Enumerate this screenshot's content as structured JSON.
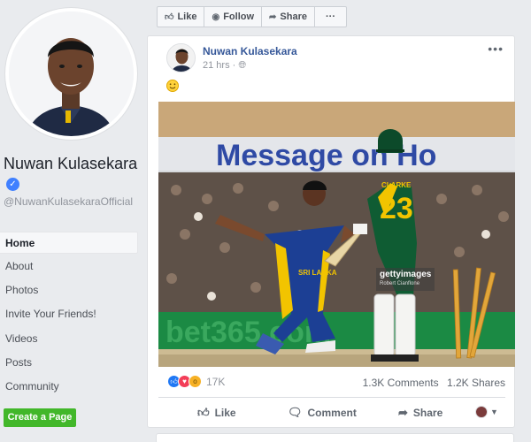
{
  "sidebar": {
    "name": "Nuwan Kulasekara",
    "handle": "@NuwanKulasekaraOfficial",
    "verified": true,
    "nav": [
      "Home",
      "About",
      "Photos",
      "Invite Your Friends!",
      "Videos",
      "Posts",
      "Community"
    ],
    "active_nav": "Home",
    "create_page_label": "Create a Page"
  },
  "action_bar": {
    "like_label": "Like",
    "follow_label": "Follow",
    "share_label": "Share",
    "more_label": "···"
  },
  "post": {
    "author": "Nuwan Kulasekara",
    "time": "21 hrs",
    "audience_icon": "globe-icon",
    "emoji": "smile-emoji",
    "photo": {
      "description_icon": "cricket-match-photo",
      "watermark": "gettyimages",
      "watermark_credit": "Robert Cianflone",
      "batsman_name": "CLARKE",
      "batsman_number": "23",
      "banner_text": "Message on Ho",
      "ground_text": "bet365.com"
    },
    "reactions": {
      "types": [
        "like",
        "love",
        "wow"
      ],
      "count": "17K"
    },
    "comments": "1.3K Comments",
    "shares": "1.2K Shares",
    "actions": {
      "like": "Like",
      "comment": "Comment",
      "share": "Share"
    }
  },
  "colors": {
    "page_bg": "#e9ebee",
    "link": "#365899",
    "create_button": "#42b72a",
    "verified": "#4080ff",
    "sl_blue": "#1c3f94",
    "sl_gold": "#f2c400",
    "aus_green": "#0f5c33"
  }
}
